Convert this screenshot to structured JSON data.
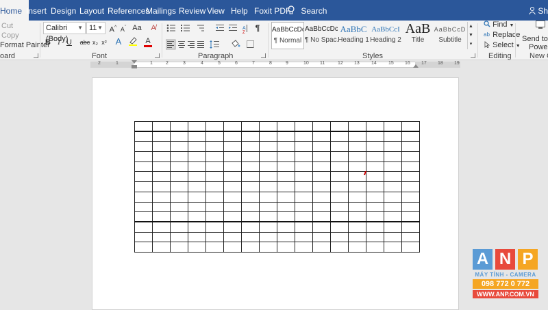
{
  "tabs": [
    {
      "label": "Home",
      "active": true
    },
    {
      "label": "Insert"
    },
    {
      "label": "Design"
    },
    {
      "label": "Layout"
    },
    {
      "label": "References"
    },
    {
      "label": "Mailings"
    },
    {
      "label": "Review"
    },
    {
      "label": "View"
    },
    {
      "label": "Help"
    },
    {
      "label": "Foxit PDF"
    }
  ],
  "tellme": {
    "label": "Search"
  },
  "share": {
    "label": "Shar"
  },
  "clipboard": {
    "cut": "Cut",
    "copy": "Copy",
    "format_painter": "Format Painter",
    "group_label": "oard"
  },
  "font": {
    "family": "Calibri (Body)",
    "size": "11",
    "grow_label": "A^",
    "shrink_label": "A˅",
    "case_label": "Aa",
    "bold": "B",
    "italic": "I",
    "underline": "U",
    "strike": "abc",
    "subscript": "x₂",
    "superscript": "x²",
    "text_effects": "A",
    "font_color": "A",
    "group_label": "Font",
    "colors": {
      "highlight": "#ffff00",
      "font_color": "#e00000"
    }
  },
  "paragraph": {
    "group_label": "Paragraph",
    "pilcrow": "¶"
  },
  "styles": {
    "group_label": "Styles",
    "items": [
      {
        "preview": "AaBbCcDc",
        "name": "¶ Normal",
        "selected": true
      },
      {
        "preview": "AaBbCcDc",
        "name": "¶ No Spac..."
      },
      {
        "preview": "AaBbC",
        "name": "Heading 1",
        "color": "#2e74b5"
      },
      {
        "preview": "AaBbCcI",
        "name": "Heading 2",
        "color": "#2e74b5"
      },
      {
        "preview": "AaB",
        "name": "Title"
      },
      {
        "preview": "AaBbCcD",
        "name": "Subtitle",
        "color": "#595959"
      }
    ]
  },
  "editing": {
    "find": "Find",
    "replace": "Replace",
    "select": "Select",
    "group_label": "Editing"
  },
  "send": {
    "line1": "Send to Mi",
    "line2": "PowerP",
    "group_label": "New Gro"
  },
  "ruler": {
    "labels": [
      "2",
      "1",
      "1",
      "2",
      "3",
      "4",
      "5",
      "6",
      "7",
      "8",
      "9",
      "10",
      "11",
      "12",
      "13",
      "14",
      "15",
      "16",
      "17",
      "18",
      "19"
    ]
  },
  "table": {
    "rows": 13,
    "cols": 16,
    "thick_after_rows": [
      1,
      10
    ]
  },
  "logo": {
    "letters": [
      "A",
      "N",
      "P"
    ],
    "colors": [
      "#5b9bd5",
      "#e84a3c",
      "#f5a623"
    ],
    "line1": "MÁY TÍNH - CAMERA",
    "line2": "098 772 0 772",
    "line3": "WWW.ANP.COM.VN"
  },
  "accent": "#2b579a"
}
